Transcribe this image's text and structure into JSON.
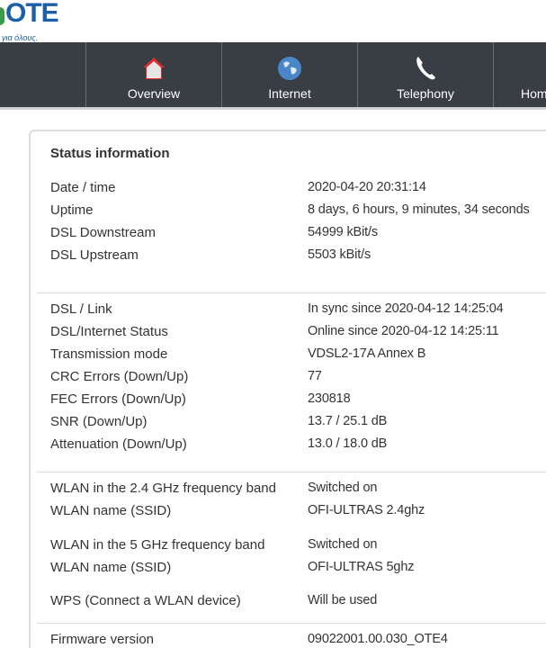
{
  "logo": {
    "brand": "OTE",
    "tagline": "για όλους."
  },
  "nav": [
    {
      "label": "Overview",
      "icon": "house-icon"
    },
    {
      "label": "Internet",
      "icon": "globe-icon"
    },
    {
      "label": "Telephony",
      "icon": "phone-icon"
    },
    {
      "label": "Hom",
      "icon": "home-network-icon"
    }
  ],
  "status": {
    "title": "Status information",
    "groups": [
      [
        {
          "label": "Date / time",
          "value": "2020-04-20 20:31:14"
        },
        {
          "label": "Uptime",
          "value": "8 days, 6 hours, 9 minutes, 34 seconds"
        },
        {
          "label": "DSL Downstream",
          "value": "54999 kBit/s"
        },
        {
          "label": "DSL Upstream",
          "value": "5503 kBit/s"
        }
      ],
      [
        {
          "label": "DSL / Link",
          "value": "In sync since 2020-04-12 14:25:04"
        },
        {
          "label": "DSL/Internet Status",
          "value": "Online since 2020-04-12 14:25:11"
        },
        {
          "label": "Transmission mode",
          "value": "VDSL2-17A Annex B"
        },
        {
          "label": "CRC Errors (Down/Up)",
          "value": "77"
        },
        {
          "label": "FEC Errors (Down/Up)",
          "value": "230818"
        },
        {
          "label": "SNR (Down/Up)",
          "value": "13.7 / 25.1 dB"
        },
        {
          "label": "Attenuation (Down/Up)",
          "value": "13.0 / 18.0 dB"
        }
      ],
      [
        {
          "label": "WLAN in the 2.4 GHz frequency band",
          "value": "Switched on"
        },
        {
          "label": "WLAN name (SSID)",
          "value": "OFI-ULTRAS 2.4ghz"
        },
        {
          "label": "WLAN in the 5 GHz frequency band",
          "value": "Switched on"
        },
        {
          "label": "WLAN name (SSID)",
          "value": "OFI-ULTRAS 5ghz"
        },
        {
          "label": "WPS (Connect a WLAN device)",
          "value": "Will be used"
        }
      ],
      [
        {
          "label": "Firmware version",
          "value": "09022001.00.030_OTE4"
        }
      ]
    ]
  }
}
